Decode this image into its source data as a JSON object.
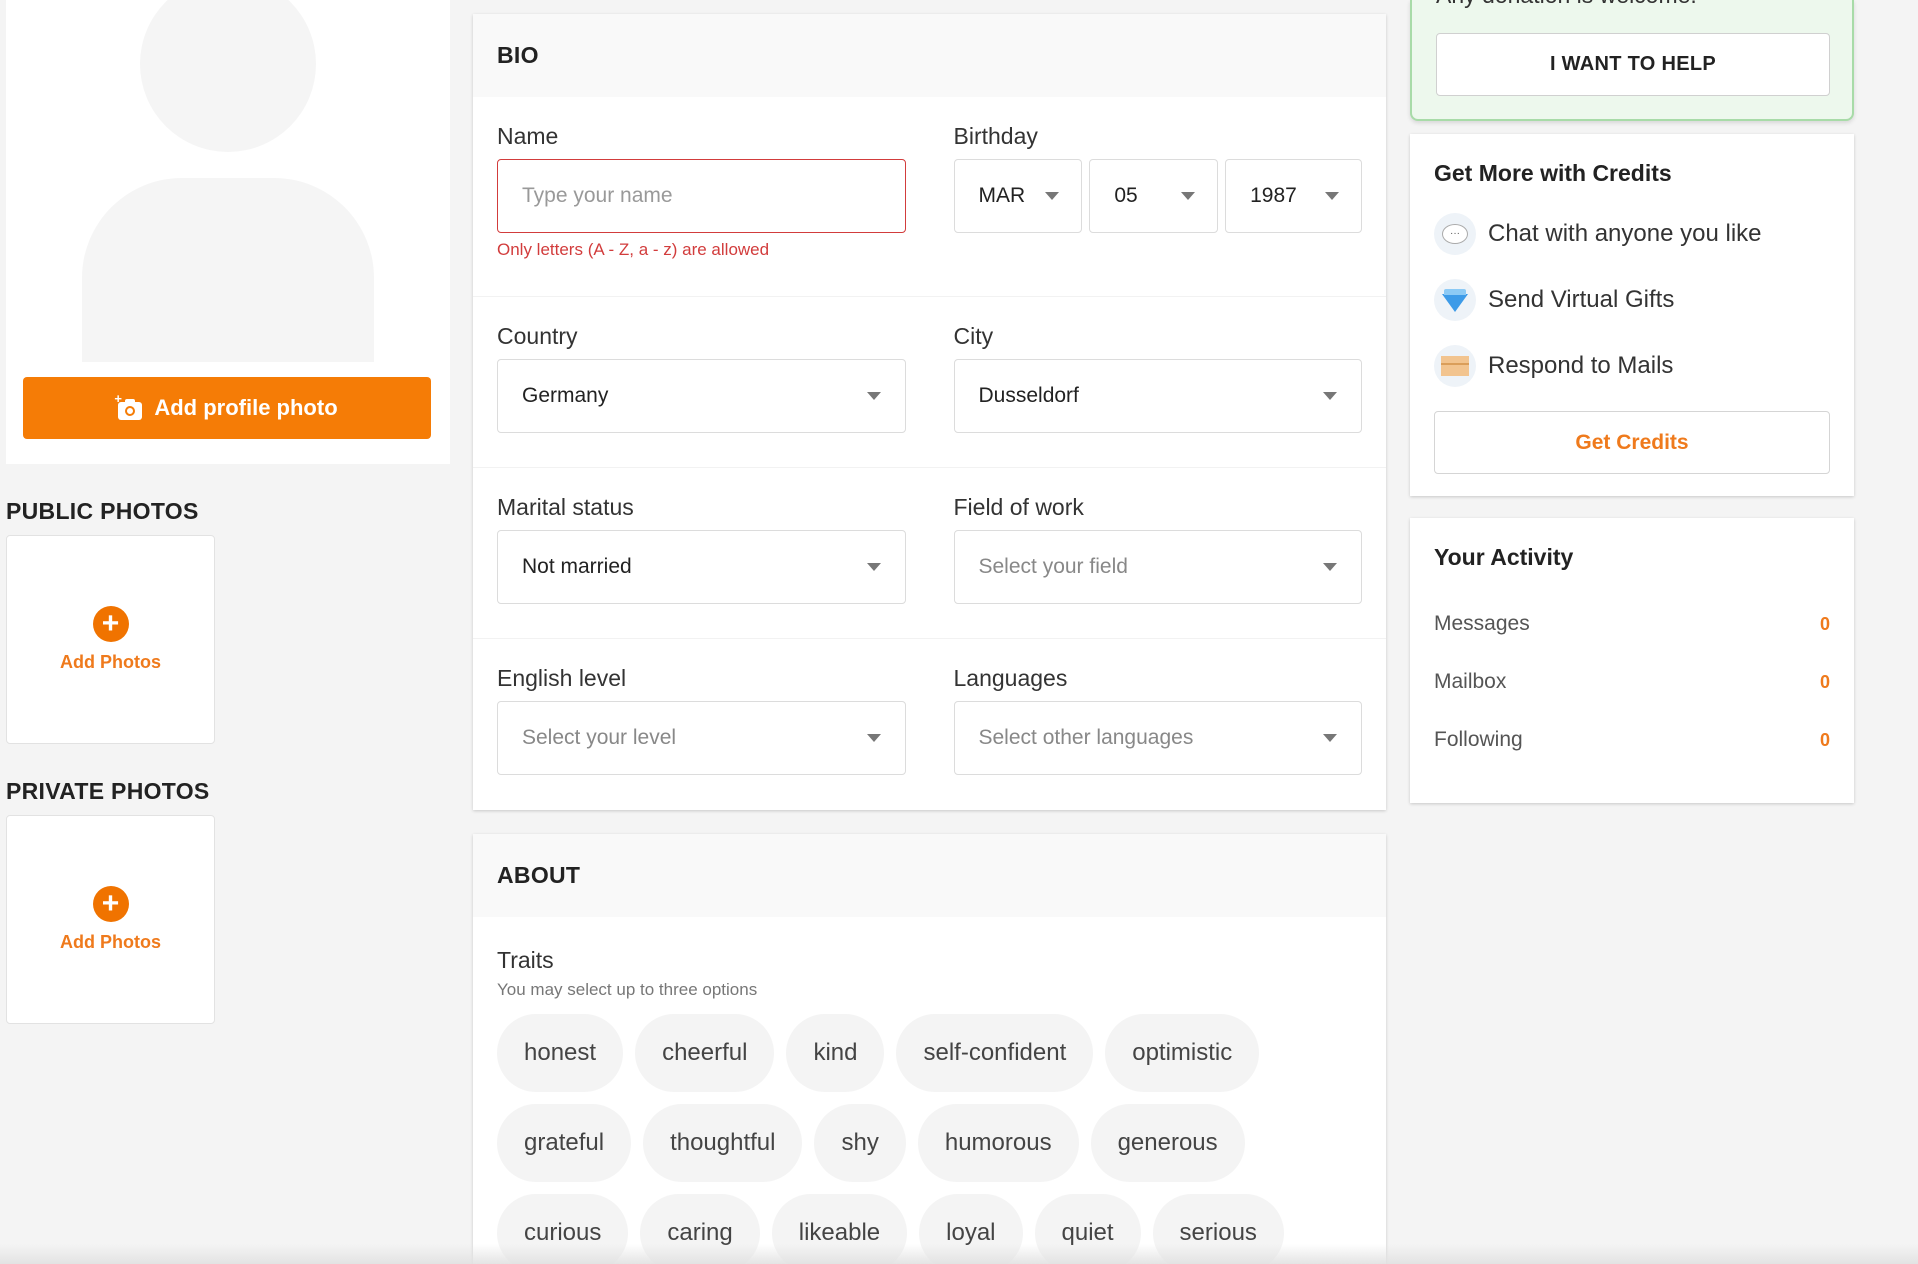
{
  "profile": {
    "add_profile_photo_label": "Add profile photo"
  },
  "photos": {
    "public_title": "PUBLIC PHOTOS",
    "private_title": "PRIVATE PHOTOS",
    "add_photos_label": "Add Photos"
  },
  "bio": {
    "title": "BIO",
    "name": {
      "label": "Name",
      "value": "",
      "placeholder": "Type your name",
      "error": "Only letters (A - Z, a - z) are allowed"
    },
    "birthday": {
      "label": "Birthday",
      "month": "MAR",
      "day": "05",
      "year": "1987"
    },
    "country": {
      "label": "Country",
      "value": "Germany"
    },
    "city": {
      "label": "City",
      "value": "Dusseldorf"
    },
    "marital_status": {
      "label": "Marital status",
      "value": "Not married"
    },
    "field_of_work": {
      "label": "Field of work",
      "placeholder": "Select your field"
    },
    "english_level": {
      "label": "English level",
      "placeholder": "Select your level"
    },
    "languages": {
      "label": "Languages",
      "placeholder": "Select other languages"
    }
  },
  "about": {
    "title": "ABOUT",
    "traits_label": "Traits",
    "traits_hint": "You may select up to three options",
    "traits": [
      "honest",
      "cheerful",
      "kind",
      "self-confident",
      "optimistic",
      "grateful",
      "thoughtful",
      "shy",
      "humorous",
      "generous",
      "curious",
      "caring",
      "likeable",
      "loyal",
      "quiet",
      "serious"
    ]
  },
  "donation": {
    "text": "Any donation is welcome.",
    "button_label": "I WANT TO HELP"
  },
  "credits": {
    "title": "Get More with Credits",
    "features": [
      {
        "icon": "chat-bubble-icon",
        "label": "Chat with anyone you like"
      },
      {
        "icon": "diamond-icon",
        "label": "Send Virtual Gifts"
      },
      {
        "icon": "envelope-icon",
        "label": "Respond to Mails"
      }
    ],
    "button_label": "Get Credits"
  },
  "activity": {
    "title": "Your Activity",
    "items": [
      {
        "label": "Messages",
        "count": "0"
      },
      {
        "label": "Mailbox",
        "count": "0"
      },
      {
        "label": "Following",
        "count": "0"
      }
    ]
  },
  "colors": {
    "accent": "#f57c06",
    "error": "#d23c3c",
    "donation_bg": "#edf8ed",
    "donation_border": "#a8dba8"
  }
}
